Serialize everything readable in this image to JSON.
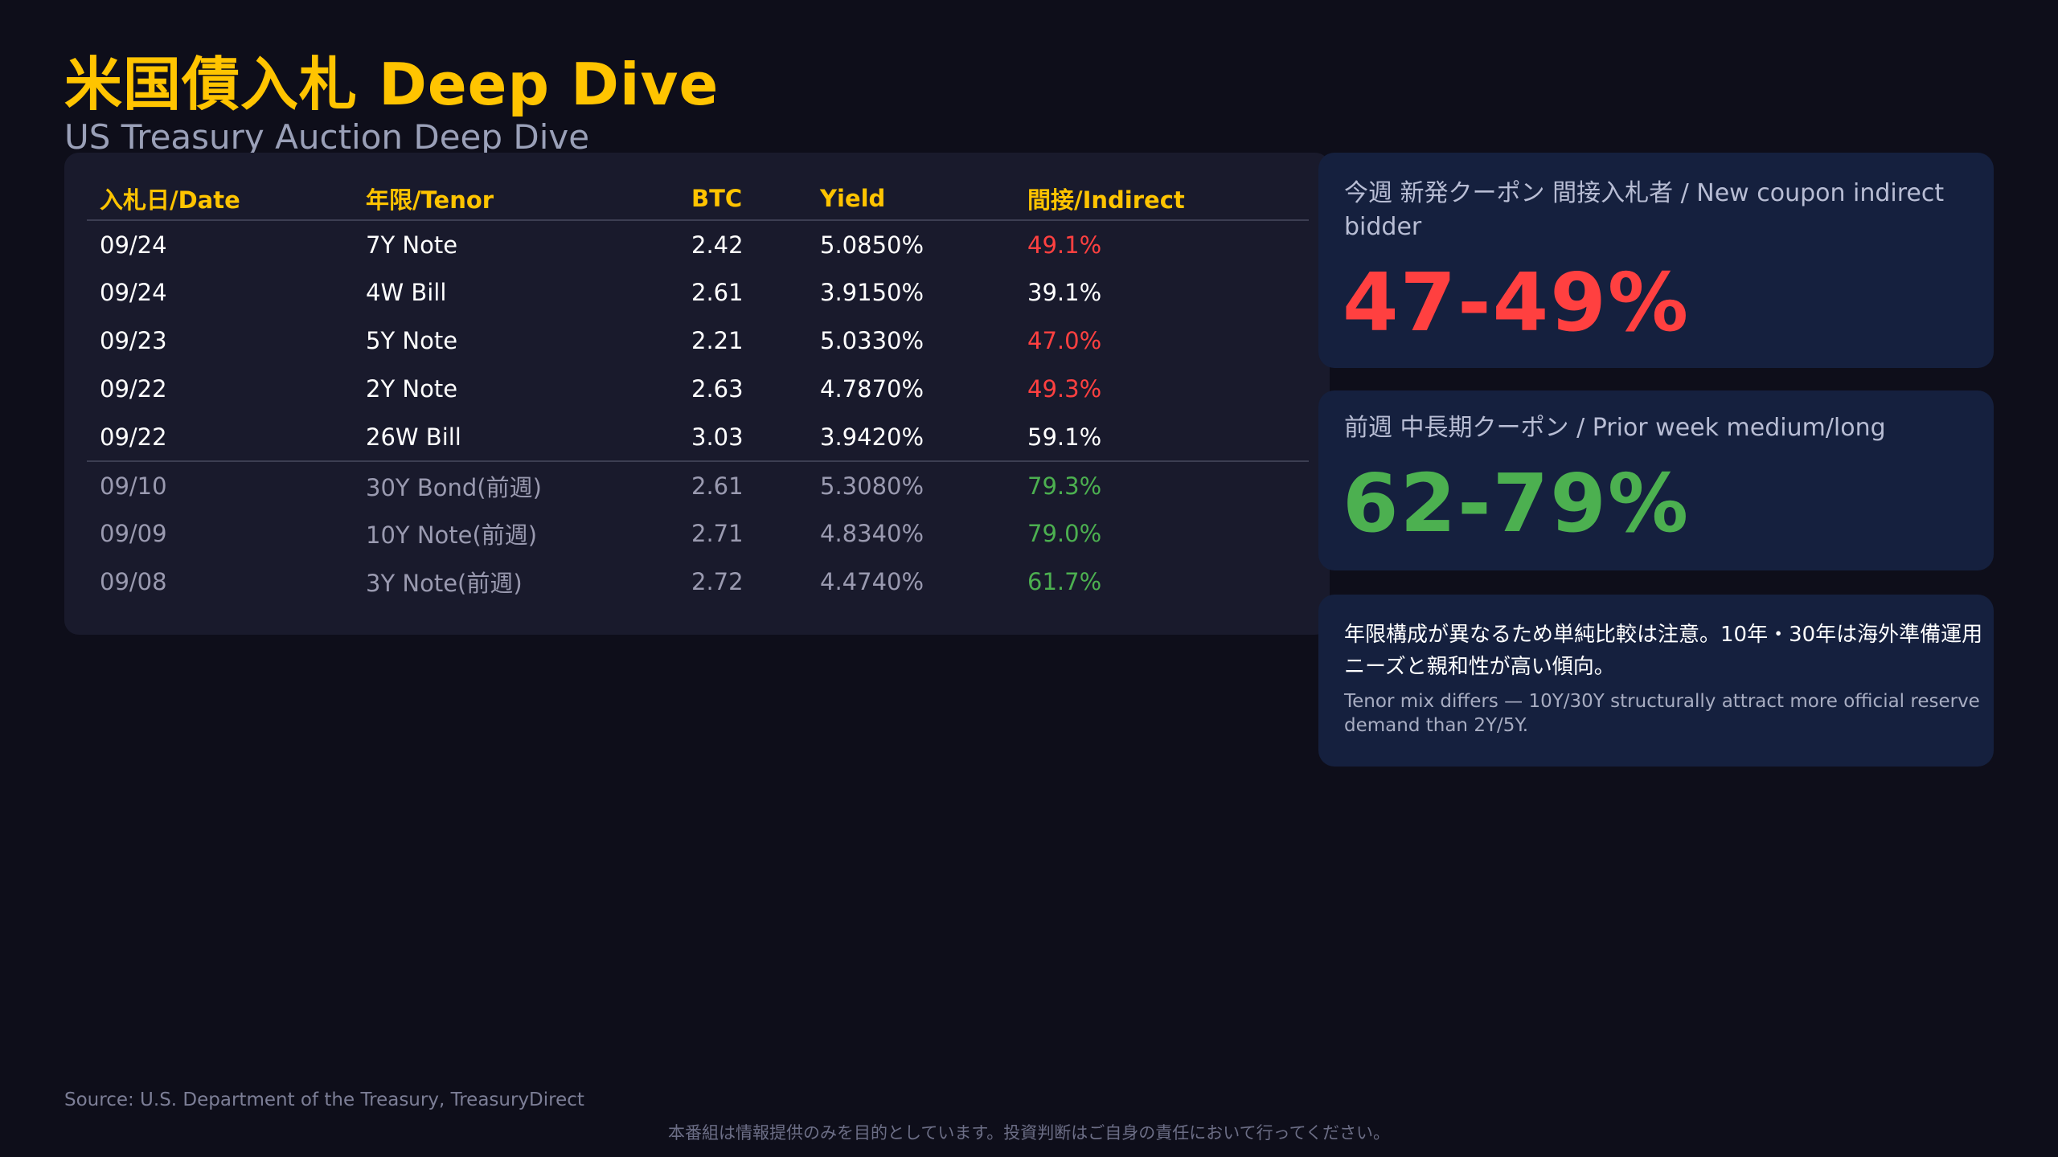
{
  "header": {
    "title": "米国債入札 Deep Dive",
    "subtitle": "US Treasury Auction Deep Dive"
  },
  "table": {
    "columns": [
      "入札日/Date",
      "年限/Tenor",
      "BTC",
      "Yield",
      "間接/Indirect"
    ],
    "rows": [
      {
        "date": "09/24",
        "tenor": "7Y Note",
        "btc": "2.42",
        "yield": "5.0850%",
        "indirect": "49.1%"
      },
      {
        "date": "09/24",
        "tenor": "4W Bill",
        "btc": "2.61",
        "yield": "3.9150%",
        "indirect": "39.1%"
      },
      {
        "date": "09/23",
        "tenor": "5Y Note",
        "btc": "2.21",
        "yield": "5.0330%",
        "indirect": "47.0%"
      },
      {
        "date": "09/22",
        "tenor": "2Y Note",
        "btc": "2.63",
        "yield": "4.7870%",
        "indirect": "49.3%"
      },
      {
        "date": "09/22",
        "tenor": "26W Bill",
        "btc": "3.03",
        "yield": "3.9420%",
        "indirect": "59.1%"
      },
      {
        "date": "09/10",
        "tenor": "30Y Bond(前週)",
        "btc": "2.61",
        "yield": "5.3080%",
        "indirect": "79.3%"
      },
      {
        "date": "09/09",
        "tenor": "10Y Note(前週)",
        "btc": "2.71",
        "yield": "4.8340%",
        "indirect": "79.0%"
      },
      {
        "date": "09/08",
        "tenor": "3Y Note(前週)",
        "btc": "2.72",
        "yield": "4.4740%",
        "indirect": "61.7%"
      }
    ]
  },
  "cards": {
    "current": {
      "label": "今週 新発クーポン 間接入札者 / New coupon indirect bidder",
      "value": "47-49%"
    },
    "prior": {
      "label": "前週 中長期クーポン / Prior week medium/long",
      "value": "62-79%"
    },
    "note": {
      "jp": "年限構成が異なるため単純比較は注意。10年・30年は海外準備運用ニーズと親和性が高い傾向。",
      "en": "Tenor mix differs — 10Y/30Y structurally attract more official reserve demand than 2Y/5Y."
    }
  },
  "footer": {
    "source": "Source: U.S. Department of the Treasury, TreasuryDirect",
    "disclaimer": "本番組は情報提供のみを目的としています。投資判断はご自身の責任において行ってください。"
  },
  "colors": {
    "accent": "#ffc400",
    "red": "#ff4040",
    "green": "#4cb050",
    "background": "#0e0e1a"
  }
}
